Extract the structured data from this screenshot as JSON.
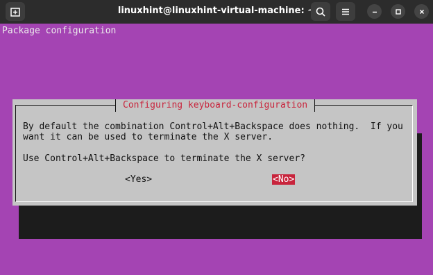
{
  "window": {
    "title": "linuxhint@linuxhint-virtual-machine: ~"
  },
  "icons": {
    "new_tab": "new-tab-icon",
    "search": "search-icon",
    "menu": "hamburger-menu-icon",
    "minimize": "minimize-icon",
    "maximize": "maximize-icon",
    "close": "close-icon"
  },
  "terminal": {
    "background": "#a444b3",
    "header": "Package configuration"
  },
  "dialog": {
    "title": "Configuring keyboard-configuration",
    "line1": "By default the combination Control+Alt+Backspace does nothing.  If you",
    "line2": "want it can be used to terminate the X server.",
    "question": "Use Control+Alt+Backspace to terminate the X server?",
    "yes_label": "<Yes>",
    "no_label": "<No>",
    "selected": "<No>",
    "accent": "#c8243c"
  }
}
